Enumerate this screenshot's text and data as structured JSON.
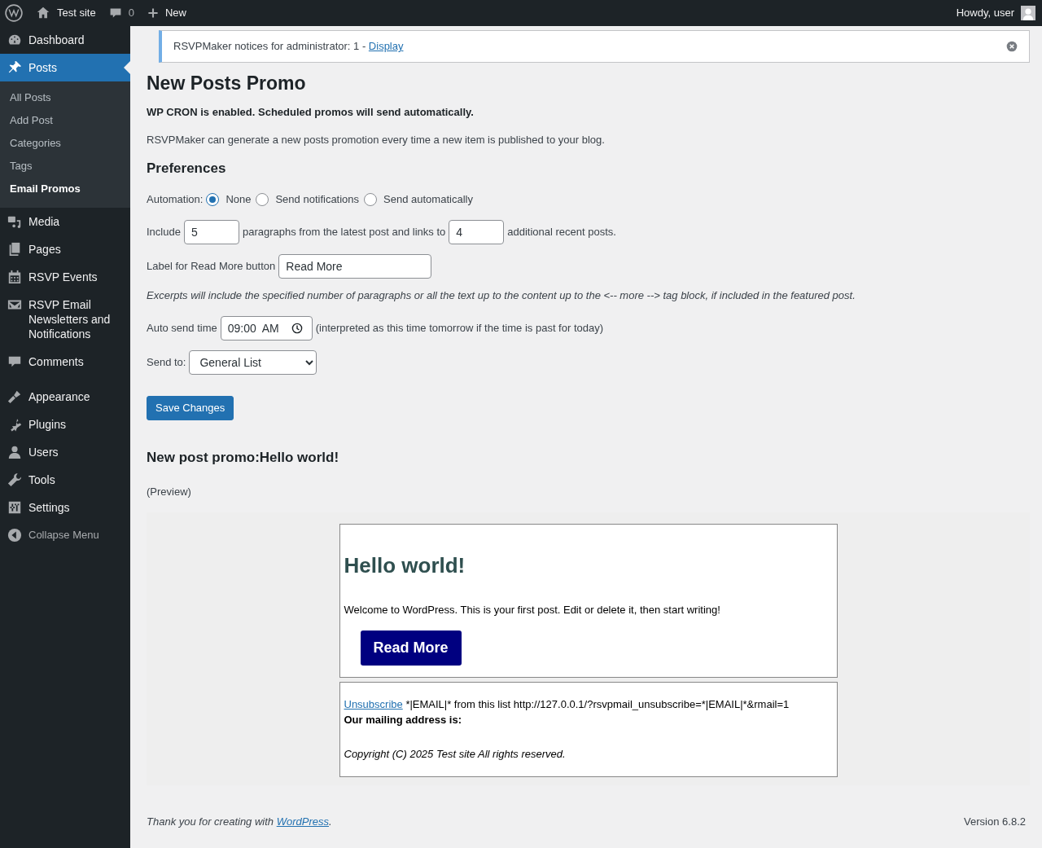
{
  "admin_bar": {
    "site_name": "Test site",
    "comments_count": "0",
    "new_label": "New",
    "greeting": "Howdy, user"
  },
  "sidebar": {
    "items": [
      {
        "label": "Dashboard",
        "selected": false
      },
      {
        "label": "Posts",
        "selected": true,
        "children": [
          {
            "label": "All Posts",
            "selected": false
          },
          {
            "label": "Add Post",
            "selected": false
          },
          {
            "label": "Categories",
            "selected": false
          },
          {
            "label": "Tags",
            "selected": false
          },
          {
            "label": "Email Promos",
            "selected": true
          }
        ]
      },
      {
        "label": "Media",
        "selected": false
      },
      {
        "label": "Pages",
        "selected": false
      },
      {
        "label": "RSVP Events",
        "selected": false
      },
      {
        "label": "RSVP Email Newsletters and Notifications",
        "selected": false
      },
      {
        "label": "Comments",
        "selected": false
      },
      {
        "label": "Appearance",
        "selected": false
      },
      {
        "label": "Plugins",
        "selected": false
      },
      {
        "label": "Users",
        "selected": false
      },
      {
        "label": "Tools",
        "selected": false
      },
      {
        "label": "Settings",
        "selected": false
      }
    ],
    "collapse_label": "Collapse Menu"
  },
  "notice": {
    "text": "RSVPMaker notices for administrator: 1 - ",
    "link": "Display"
  },
  "title": "New Posts Promo",
  "cron_note": "WP CRON is enabled. Scheduled promos will send automatically.",
  "intro": "RSVPMaker can generate a new posts promotion every time a new item is published to your blog.",
  "preferences_heading": "Preferences",
  "automation": {
    "label": "Automation:",
    "options": [
      {
        "label": "None",
        "selected": true
      },
      {
        "label": "Send notifications",
        "selected": false
      },
      {
        "label": "Send automatically",
        "selected": false
      }
    ]
  },
  "include": {
    "prefix": "Include",
    "paragraphs": "5",
    "middle": "paragraphs from the latest post and links to",
    "links": "4",
    "suffix": "additional recent posts."
  },
  "read_more": {
    "label": "Label for Read More button",
    "value": "Read More"
  },
  "excerpt_note": "Excerpts will include the specified number of paragraphs or all the text up to the content up to the <-- more --> tag block, if included in the featured post.",
  "send_time": {
    "label": "Auto send time",
    "value": "09:00  AM",
    "note": "(interpreted as this time tomorrow if the time is past for today)"
  },
  "send_to": {
    "label": "Send to:",
    "value": "General List"
  },
  "save_button": "Save Changes",
  "promo": {
    "heading": "New post promo:Hello world!",
    "preview_label": "(Preview)",
    "email": {
      "title": "Hello world!",
      "body": "Welcome to WordPress. This is your first post. Edit or delete it, then start writing!",
      "button": "Read More",
      "unsubscribe_link": "Unsubscribe",
      "unsubscribe_text": " *|EMAIL|* from this list http://127.0.0.1/?rsvpmail_unsubscribe=*|EMAIL|*&rmail=1",
      "address_label": "Our mailing address is:",
      "copyright": "Copyright (C) 2025 Test site All rights reserved."
    }
  },
  "footer": {
    "thanks": "Thank you for creating with ",
    "link": "WordPress",
    "after": ".",
    "version": "Version 6.8.2"
  }
}
